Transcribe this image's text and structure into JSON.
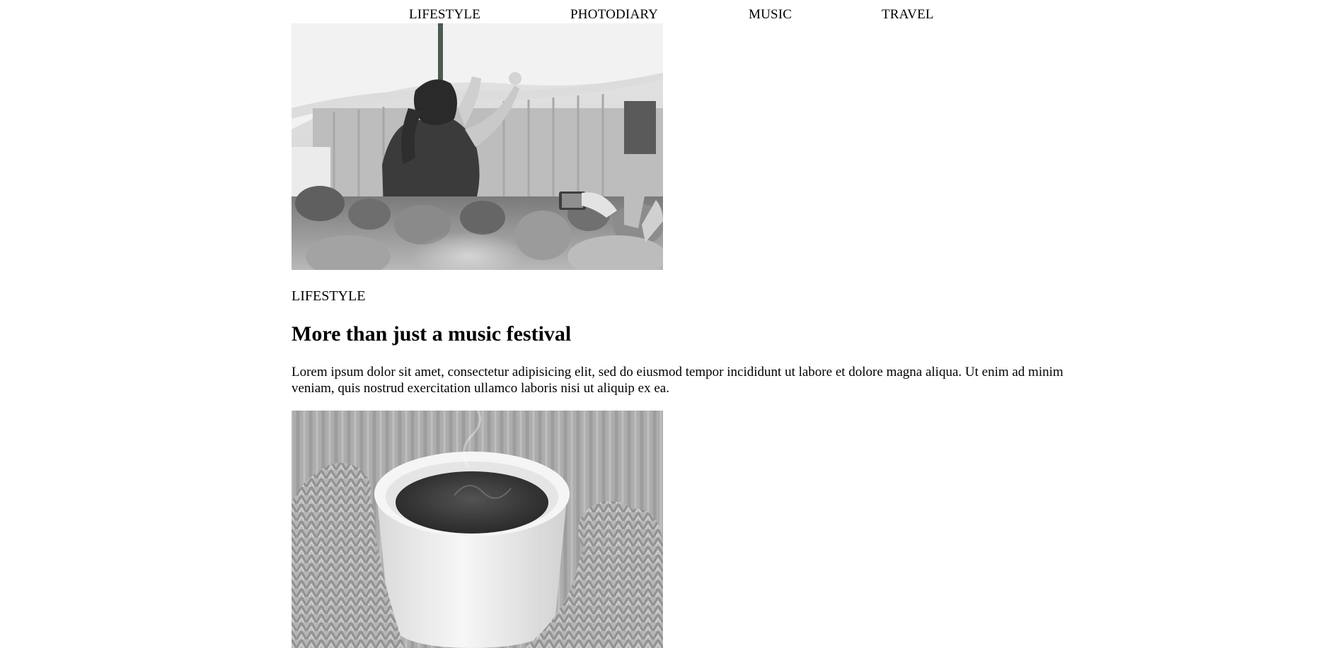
{
  "nav": {
    "items": [
      {
        "label": "LIFESTYLE"
      },
      {
        "label": "PHOTODIARY"
      },
      {
        "label": "MUSIC"
      },
      {
        "label": "TRAVEL"
      }
    ]
  },
  "post": {
    "category": "LIFESTYLE",
    "title": "More than just a music festival",
    "excerpt": "Lorem ipsum dolor sit amet, consectetur adipisicing elit, sed do eiusmod tempor incididunt ut labore et dolore magna aliqua. Ut enim ad minim veniam, quis nostrud exercitation ullamco laboris nisi ut aliquip ex ea."
  },
  "images": [
    {
      "subject": "woman dancing above concert crowd, black and white"
    },
    {
      "subject": "hands in knitted mittens holding a steaming cup of coffee, black and white"
    }
  ]
}
